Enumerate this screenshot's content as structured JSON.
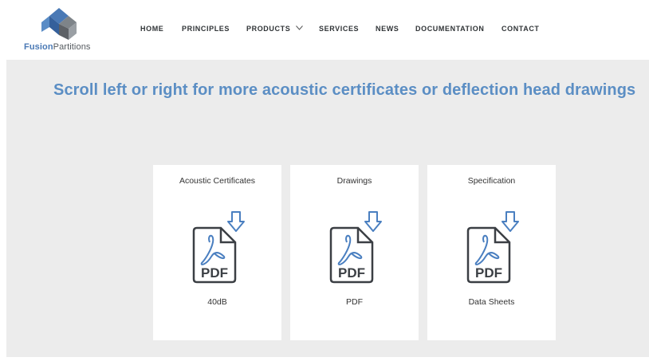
{
  "brand": {
    "logo_part1": "Fusion",
    "logo_part2": "Partitions",
    "colors": {
      "blue": "#4a79b5",
      "grey": "#555a5f",
      "headline": "#5b8ec4"
    }
  },
  "nav": {
    "items": [
      {
        "label": "HOME"
      },
      {
        "label": "PRINCIPLES"
      },
      {
        "label": "PRODUCTS",
        "has_dropdown": true
      },
      {
        "label": "SERVICES"
      },
      {
        "label": "NEWS"
      },
      {
        "label": "DOCUMENTATION"
      },
      {
        "label": "CONTACT"
      }
    ]
  },
  "main": {
    "headline": "Scroll left or right for more acoustic certificates or deflection head drawings",
    "cards": [
      {
        "title": "Acoustic Certificates",
        "icon": "pdf-download-icon",
        "caption": "40dB"
      },
      {
        "title": "Drawings",
        "icon": "pdf-download-icon",
        "caption": "PDF"
      },
      {
        "title": "Specification",
        "icon": "pdf-download-icon",
        "caption": "Data Sheets"
      }
    ],
    "pdf_label": "PDF"
  }
}
